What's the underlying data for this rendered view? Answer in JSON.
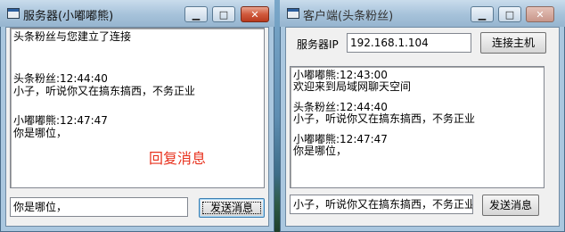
{
  "server_window": {
    "title": "服务器(小嘟嘟熊)",
    "controls": {
      "minimize": "▁",
      "maximize": "□",
      "close": "✕"
    },
    "chat_lines": [
      "头条粉丝与您建立了连接",
      "头条粉丝:12:44:40",
      "小子，听说你又在搞东搞西，不务正业",
      "小嘟嘟熊:12:47:47",
      "你是哪位，"
    ],
    "message_input": "你是哪位，",
    "send_button": "发送消息",
    "overlay_text": "回复消息",
    "overlay_color": "#e8321e"
  },
  "client_window": {
    "title": "客户端(头条粉丝)",
    "controls": {
      "minimize": "▁",
      "maximize": "□",
      "close": "✕"
    },
    "server_ip_label": "服务器IP",
    "server_ip_value": "192.168.1.104",
    "connect_button": "连接主机",
    "chat_lines": [
      "小嘟嘟熊:12:43:00",
      "欢迎来到局域网聊天空间",
      "头条粉丝:12:44:40",
      "小子，听说你又在搞东搞西，不务正业",
      "小嘟嘟熊:12:47:47",
      "你是哪位，"
    ],
    "message_input": "小子，听说你又在搞东搞西，不务正业",
    "send_button": "发送消息"
  }
}
